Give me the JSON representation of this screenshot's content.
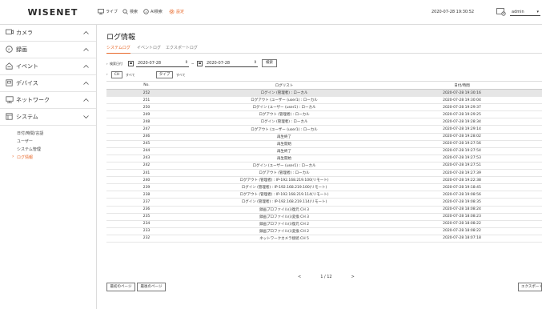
{
  "header": {
    "logo": "WISENET",
    "nav": {
      "live": "ライブ",
      "search": "検索",
      "ai": "AI検索",
      "setup": "設定"
    },
    "clock": "2020-07-28 19:30:52",
    "user": "admin"
  },
  "sidebar": {
    "items": [
      {
        "label": "カメラ",
        "icon": "camera-icon"
      },
      {
        "label": "録画",
        "icon": "record-icon"
      },
      {
        "label": "イベント",
        "icon": "event-icon"
      },
      {
        "label": "デバイス",
        "icon": "device-icon"
      },
      {
        "label": "ネットワーク",
        "icon": "network-icon"
      },
      {
        "label": "システム",
        "icon": "system-icon"
      }
    ],
    "subitems": [
      "日付/時間/言語",
      "ユーザー",
      "システム管理",
      "ログ情報"
    ],
    "active_subitem": "ログ情報"
  },
  "main": {
    "title": "ログ情報",
    "tabs": [
      "システムログ",
      "イベントログ",
      "エクスポートログ"
    ],
    "active_tab": "システムログ",
    "filter": {
      "period_label": "検索日付",
      "start_date": "2020-07-28",
      "separator": "~",
      "end_date": "2020-07-28",
      "search_button": "検索"
    },
    "ch_filter": {
      "ch_button": "CH",
      "ch_value": "すべて",
      "type_button": "タイプ",
      "type_value": "すべて"
    },
    "table": {
      "columns": [
        "No.",
        "ログリスト",
        "日付/時間"
      ],
      "rows": [
        [
          "252",
          "ログイン (管理者) : ローカル",
          "2020-07-28 19:30:16"
        ],
        [
          "251",
          "ログアウト (ユーザー (user1) : ローカル",
          "2020-07-28 19:30:04"
        ],
        [
          "250",
          "ログイン (ユーザー (user1) : ローカル",
          "2020-07-28 19:29:37"
        ],
        [
          "249",
          "ログアウト (管理者) : ローカル",
          "2020-07-28 19:29:25"
        ],
        [
          "248",
          "ログイン (管理者) : ローカル",
          "2020-07-28 19:28:34"
        ],
        [
          "247",
          "ログアウト (ユーザー (user1) : ローカル",
          "2020-07-28 19:29:14"
        ],
        [
          "246",
          "再生終了",
          "2020-07-28 19:28:02"
        ],
        [
          "245",
          "再生開始",
          "2020-07-28 19:27:56"
        ],
        [
          "244",
          "再生終了",
          "2020-07-28 19:27:54"
        ],
        [
          "243",
          "再生開始",
          "2020-07-28 19:27:53"
        ],
        [
          "242",
          "ログイン (ユーザー (user1) : ローカル",
          "2020-07-28 19:27:51"
        ],
        [
          "241",
          "ログアウト (管理者) : ローカル",
          "2020-07-28 19:27:39"
        ],
        [
          "240",
          "ログアウト (管理者) : IP-192.168.219.100(リモート)",
          "2020-07-28 19:22:38"
        ],
        [
          "239",
          "ログイン (管理者) : IP-192.168.219.100(リモート)",
          "2020-07-28 19:18:45"
        ],
        [
          "238",
          "ログアウト (管理者) : IP-192.168.219.114(リモート)",
          "2020-07-28 19:08:56"
        ],
        [
          "237",
          "ログイン (管理者) : IP-192.168.219.114(リモート)",
          "2020-07-28 19:08:35"
        ],
        [
          "236",
          "録画プロファイル(i)復元 CH 3",
          "2020-07-28 18:08:24"
        ],
        [
          "235",
          "録画プロファイル(i)変換 CH 3",
          "2020-07-28 18:08:23"
        ],
        [
          "234",
          "録画プロファイル(i)復元 CH 2",
          "2020-07-28 18:08:22"
        ],
        [
          "233",
          "録画プロファイル(i)変換 CH 2",
          "2020-07-28 18:08:22"
        ],
        [
          "232",
          "ネットワークカメラ接続 CH 5",
          "2020-07-28 18:07:18"
        ]
      ],
      "selected_row": 0
    },
    "pager": {
      "prev": "<",
      "page": "1 / 12",
      "next": ">"
    },
    "buttons": {
      "first_page": "最初のページ",
      "last_page": "最後のページ",
      "export": "エクスポート"
    }
  },
  "colors": {
    "accent": "#e8692b",
    "selected_row": "#e6e6e6",
    "border": "#dcdcdc"
  }
}
